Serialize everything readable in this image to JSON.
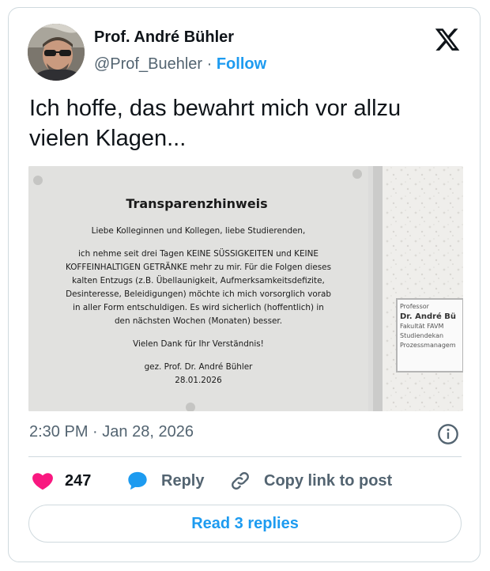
{
  "author": {
    "name": "Prof. André Bühler",
    "handle": "@Prof_Buehler",
    "separator": "·",
    "follow_label": "Follow"
  },
  "brand": {
    "logo_icon": "x-logo-icon"
  },
  "tweet": {
    "text": "Ich hoffe, das bewahrt mich vor allzu vielen Klagen..."
  },
  "photo": {
    "notice_title": "Transparenzhinweis",
    "notice_lines": [
      "Liebe Kolleginnen und Kollegen, liebe Studierenden,",
      "ich nehme seit drei Tagen KEINE SÜSSIGKEITEN und KEINE",
      "KOFFEINHALTIGEN GETRÄNKE mehr zu mir. Für die Folgen dieses",
      "kalten Entzugs (z.B. Übellaunigkeit, Aufmerksamkeitsdefizite,",
      "Desinteresse, Beleidigungen) möchte ich mich vorsorglich vorab",
      "in aller Form entschuldigen. Es wird sicherlich (hoffentlich) in",
      "den nächsten Wochen (Monaten) besser.",
      "Vielen Dank für Ihr Verständnis!",
      "gez. Prof. Dr. André Bühler",
      "28.01.2026"
    ],
    "door_sign_lines": [
      "Professor",
      "Dr. André Bü",
      "Fakultät FAVM",
      "Studiendekan",
      "Prozessmanagem"
    ]
  },
  "meta": {
    "time": "2:30 PM",
    "separator": "·",
    "date": "Jan 28, 2026",
    "info_icon": "info-icon"
  },
  "actions": {
    "like_count": "247",
    "reply_label": "Reply",
    "copy_label": "Copy link to post"
  },
  "read_replies_label": "Read 3 replies",
  "colors": {
    "accent": "#1d9bf0",
    "like": "#f91880",
    "text": "#0f1419",
    "muted": "#536471",
    "border": "#cfd9de"
  }
}
